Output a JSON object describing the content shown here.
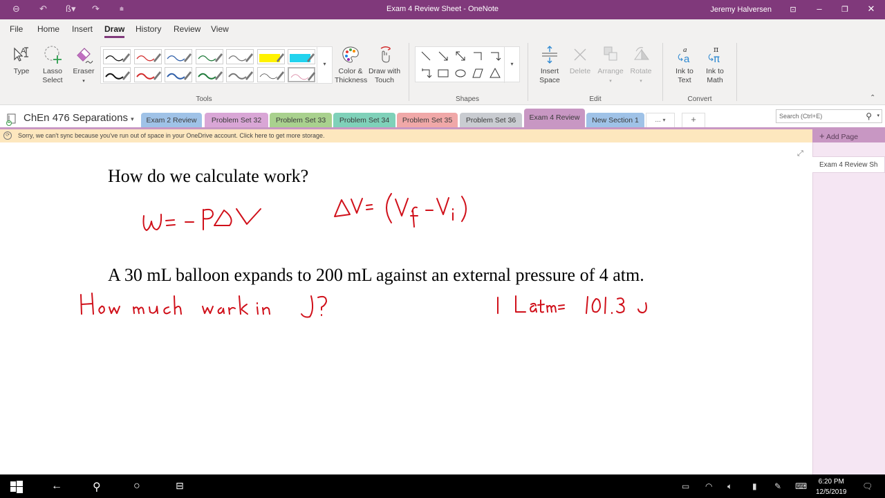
{
  "window": {
    "title": "Exam 4 Review Sheet - OneNote",
    "user": "Jeremy Halversen",
    "quick_access": [
      "back-icon",
      "undo-icon",
      "pen-mode-icon",
      "redo-icon",
      "customize-icon"
    ]
  },
  "menu": {
    "items": [
      {
        "label": "File"
      },
      {
        "label": "Home"
      },
      {
        "label": "Insert"
      },
      {
        "label": "Draw",
        "active": true
      },
      {
        "label": "History"
      },
      {
        "label": "Review"
      },
      {
        "label": "View"
      }
    ]
  },
  "ribbon": {
    "tools": {
      "type_label": "Type",
      "lasso_label_1": "Lasso",
      "lasso_label_2": "Select",
      "eraser_label": "Eraser",
      "group_label": "Tools",
      "pens": [
        {
          "color": "#111111",
          "kind": "pen"
        },
        {
          "color": "#d22b2b",
          "kind": "pen"
        },
        {
          "color": "#2e5ea8",
          "kind": "pen"
        },
        {
          "color": "#1f7a3a",
          "kind": "pen"
        },
        {
          "color": "#777777",
          "kind": "pen"
        },
        {
          "color": "#fff200",
          "kind": "highlighter"
        },
        {
          "color": "#22d3ee",
          "kind": "highlighter"
        },
        {
          "color": "#111111",
          "kind": "pen-thick"
        },
        {
          "color": "#d22b2b",
          "kind": "pen-thick"
        },
        {
          "color": "#2e5ea8",
          "kind": "pen-thick"
        },
        {
          "color": "#1f7a3a",
          "kind": "pen-thick"
        },
        {
          "color": "#777777",
          "kind": "pen-thick"
        },
        {
          "color": "#444444",
          "kind": "pen-thin"
        },
        {
          "color": "#d77a9a",
          "kind": "pen-thin",
          "selected": true
        }
      ],
      "color_thickness_1": "Color &",
      "color_thickness_2": "Thickness",
      "draw_touch_1": "Draw with",
      "draw_touch_2": "Touch"
    },
    "shapes": {
      "group_label": "Shapes",
      "items": [
        "line",
        "arrow",
        "double-arrow",
        "elbow",
        "elbow-arrow",
        "elbow-arrow-left",
        "rectangle",
        "ellipse",
        "parallelogram",
        "triangle"
      ]
    },
    "edit": {
      "group_label": "Edit",
      "insert_space_1": "Insert",
      "insert_space_2": "Space",
      "delete": "Delete",
      "arrange": "Arrange",
      "rotate": "Rotate"
    },
    "convert": {
      "group_label": "Convert",
      "ink_text_1": "Ink to",
      "ink_text_2": "Text",
      "ink_math_1": "Ink to",
      "ink_math_2": "Math"
    }
  },
  "notebook": {
    "name": "ChEn 476 Separations",
    "sections": [
      {
        "label": "Exam 2 Review",
        "color": "#9fc2e7"
      },
      {
        "label": "Problem Set 32",
        "color": "#d9a6d6"
      },
      {
        "label": "Problem Set 33",
        "color": "#a9d18e"
      },
      {
        "label": "Problem Set 34",
        "color": "#7fd1b9"
      },
      {
        "label": "Problem Set 35",
        "color": "#f0a8a8"
      },
      {
        "label": "Problem Set 36",
        "color": "#c9ccd1"
      },
      {
        "label": "Exam 4 Review",
        "color": "#c897c3",
        "active": true
      },
      {
        "label": "New Section 1",
        "color": "#9fc2e7"
      }
    ],
    "more_label": "...",
    "add_label": "+"
  },
  "search": {
    "placeholder": "Search (Ctrl+E)"
  },
  "notice": {
    "text": "Sorry, we can't sync because you've run out of space in your OneDrive account. Click here to get more storage."
  },
  "pages": {
    "add_label": "Add Page",
    "items": [
      {
        "label": "Exam 4 Review Sh"
      }
    ]
  },
  "content": {
    "heading1": "How do we calculate work?",
    "ink1": "W = - PΔV",
    "ink2": "ΔV = (Vf - Vi)",
    "problem": "A 30 mL balloon expands to 200 mL against an external pressure of 4 atm.",
    "ink3": "How much work in J?",
    "ink4": "1 Latm = 101.3 J",
    "ink_color": "#d0101a"
  },
  "taskbar": {
    "time": "6:20 PM",
    "date": "12/5/2019"
  }
}
